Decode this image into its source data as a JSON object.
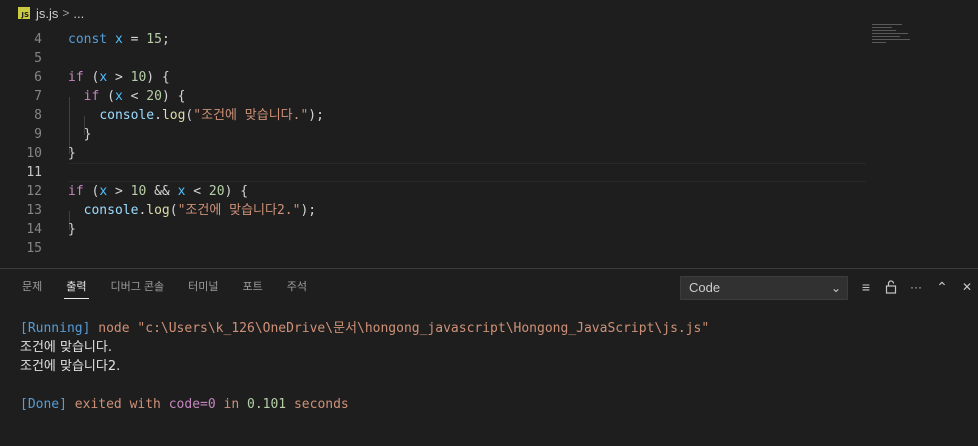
{
  "breadcrumb": {
    "badge": "JS",
    "file": "js.js",
    "separator": ">",
    "ellipsis": "..."
  },
  "editor": {
    "line_numbers": [
      "4",
      "5",
      "6",
      "7",
      "8",
      "9",
      "10",
      "11",
      "12",
      "13",
      "14",
      "15"
    ],
    "active_line": "11",
    "code": {
      "l4": {
        "kw": "const",
        "var": "x",
        "op": " = ",
        "num": "15",
        "end": ";"
      },
      "l6": {
        "kw": "if",
        "open": " (",
        "var": "x",
        "op": " > ",
        "num": "10",
        "close": ") {"
      },
      "l7": {
        "kw": "if",
        "open": " (",
        "var": "x",
        "op": " < ",
        "num": "20",
        "close": ") {"
      },
      "l8": {
        "obj": "console",
        "dot": ".",
        "fn": "log",
        "open": "(",
        "str": "\"조건에 맞습니다.\"",
        "close": ");"
      },
      "l9": {
        "text": "}"
      },
      "l10": {
        "text": "}"
      },
      "l12": {
        "kw": "if",
        "open": " (",
        "var1": "x",
        "op1": " > ",
        "num1": "10",
        "and": " && ",
        "var2": "x",
        "op2": " < ",
        "num2": "20",
        "close": ") {"
      },
      "l13": {
        "obj": "console",
        "dot": ".",
        "fn": "log",
        "open": "(",
        "str": "\"조건에 맞습니다2.\"",
        "close": ");"
      },
      "l14": {
        "text": "}"
      }
    }
  },
  "panel": {
    "tabs": [
      "문제",
      "출력",
      "디버그 콘솔",
      "터미널",
      "포트",
      "주석"
    ],
    "active_tab": "출력",
    "output_select": {
      "value": "Code",
      "chevron": "⌄"
    },
    "icons": {
      "filter": "≡",
      "lock": "🔓",
      "more": "···",
      "up": "⌃",
      "close": "✕"
    },
    "output": {
      "running_tag": "[Running]",
      "running_cmd": " node \"c:\\Users\\k_126\\OneDrive\\문서\\hongong_javascript\\Hongong_JavaScript\\js.js\"",
      "line1": "조건에 맞습니다.",
      "line2": "조건에 맞습니다2.",
      "done_tag": "[Done]",
      "done_text1": " exited with ",
      "done_code": "code=0",
      "done_text2": " in ",
      "done_time": "0.101",
      "done_text3": " seconds"
    }
  }
}
